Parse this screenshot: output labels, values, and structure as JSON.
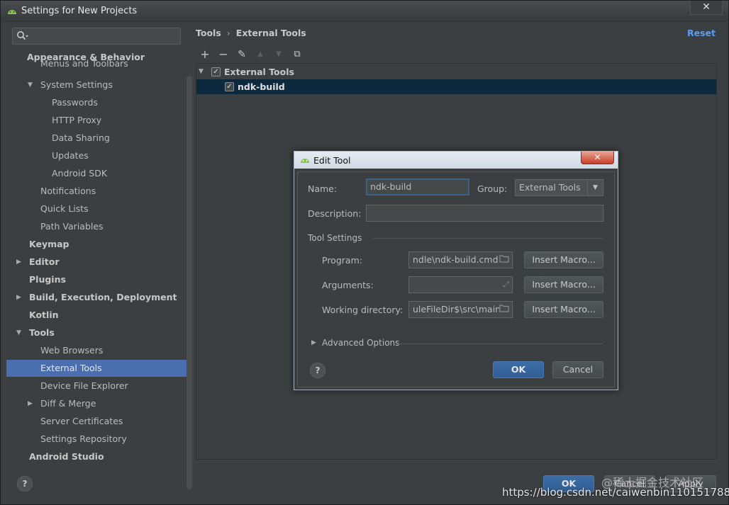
{
  "window": {
    "title": "Settings for New Projects",
    "close_glyph": "✕"
  },
  "sidebar": {
    "search_placeholder": "",
    "items": [
      {
        "label": "Appearance & Behavior"
      },
      {
        "label": "Menus and Toolbars"
      },
      {
        "label": "System Settings"
      },
      {
        "label": "Passwords"
      },
      {
        "label": "HTTP Proxy"
      },
      {
        "label": "Data Sharing"
      },
      {
        "label": "Updates"
      },
      {
        "label": "Android SDK"
      },
      {
        "label": "Notifications"
      },
      {
        "label": "Quick Lists"
      },
      {
        "label": "Path Variables"
      },
      {
        "label": "Keymap"
      },
      {
        "label": "Editor"
      },
      {
        "label": "Plugins"
      },
      {
        "label": "Build, Execution, Deployment"
      },
      {
        "label": "Kotlin"
      },
      {
        "label": "Tools"
      },
      {
        "label": "Web Browsers"
      },
      {
        "label": "External Tools"
      },
      {
        "label": "Device File Explorer"
      },
      {
        "label": "Diff & Merge"
      },
      {
        "label": "Server Certificates"
      },
      {
        "label": "Settings Repository"
      },
      {
        "label": "Android Studio"
      }
    ],
    "selected": "External Tools"
  },
  "main": {
    "breadcrumb": [
      "Tools",
      "External Tools"
    ],
    "breadcrumb_sep": "›",
    "reset_label": "Reset",
    "toolbar": {
      "add": "+",
      "remove": "−",
      "edit": "✎",
      "up": "▲",
      "down": "▼",
      "copy": "⧉"
    },
    "tree": {
      "group": {
        "label": "External Tools",
        "checked": true
      },
      "tool": {
        "label": "ndk-build",
        "checked": true
      }
    }
  },
  "dialog": {
    "title": "Edit Tool",
    "close_glyph": "✕",
    "name_label": "Name:",
    "name_value": "ndk-build",
    "group_label": "Group:",
    "group_value": "External Tools",
    "description_label": "Description:",
    "description_value": "",
    "tool_settings_label": "Tool Settings",
    "program_label": "Program:",
    "program_value": "ndle\\ndk-build.cmd",
    "arguments_label": "Arguments:",
    "arguments_value": "",
    "workdir_label": "Working directory:",
    "workdir_value": "uleFileDir$\\src\\main",
    "insert_macro_label": "Insert Macro...",
    "advanced_label": "Advanced Options",
    "ok_label": "OK",
    "cancel_label": "Cancel",
    "help_glyph": "?"
  },
  "footer": {
    "help_glyph": "?",
    "ok_label": "OK",
    "cancel_label": "Cancel",
    "apply_label": "Apply"
  },
  "watermark": {
    "line1": "@稀土掘金技术社区",
    "line2": "https://blog.csdn.net/caiwenbin1101517886"
  },
  "colors": {
    "selection": "#4b6eaf",
    "link": "#589df6",
    "primary_button": "#365f9a"
  }
}
